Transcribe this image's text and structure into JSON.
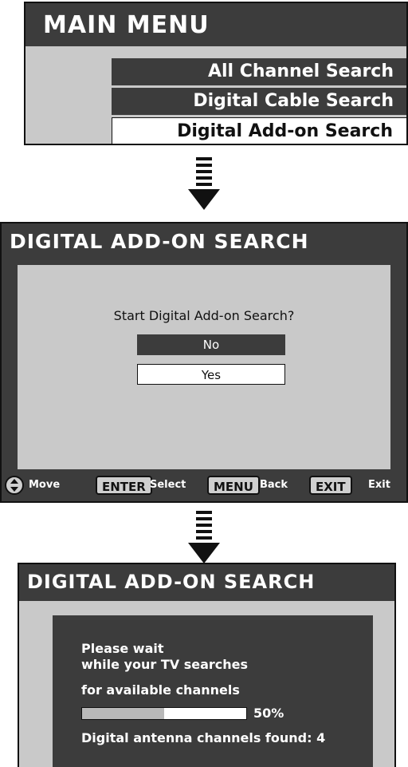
{
  "main_menu": {
    "title": "MAIN MENU",
    "items": [
      {
        "label": "All Channel Search",
        "selected": false
      },
      {
        "label": "Digital Cable Search",
        "selected": false
      },
      {
        "label": "Digital Add-on Search",
        "selected": true
      }
    ]
  },
  "confirm_screen": {
    "title": "DIGITAL ADD-ON SEARCH",
    "prompt": "Start Digital Add-on Search?",
    "options": [
      {
        "label": "No",
        "selected": false
      },
      {
        "label": "Yes",
        "selected": true
      }
    ],
    "footer": {
      "move": "Move",
      "enter_key": "ENTER",
      "enter_action": "Select",
      "menu_key": "MENU",
      "menu_action": "Back",
      "exit_key": "EXIT",
      "exit_action": "Exit"
    }
  },
  "progress_screen": {
    "title": "DIGITAL ADD-ON SEARCH",
    "line1": "Please wait",
    "line2": "while your TV searches",
    "line3": "for available channels",
    "progress_percent": 50,
    "progress_label": "50%",
    "found_text": "Digital antenna channels found: 4"
  },
  "colors": {
    "panel_dark": "#3c3c3c",
    "panel_light": "#c9c9c9",
    "highlight": "#ffffff"
  },
  "icons": {
    "flow_arrow": "down-arrow-icon",
    "navigation": "dpad-icon"
  }
}
